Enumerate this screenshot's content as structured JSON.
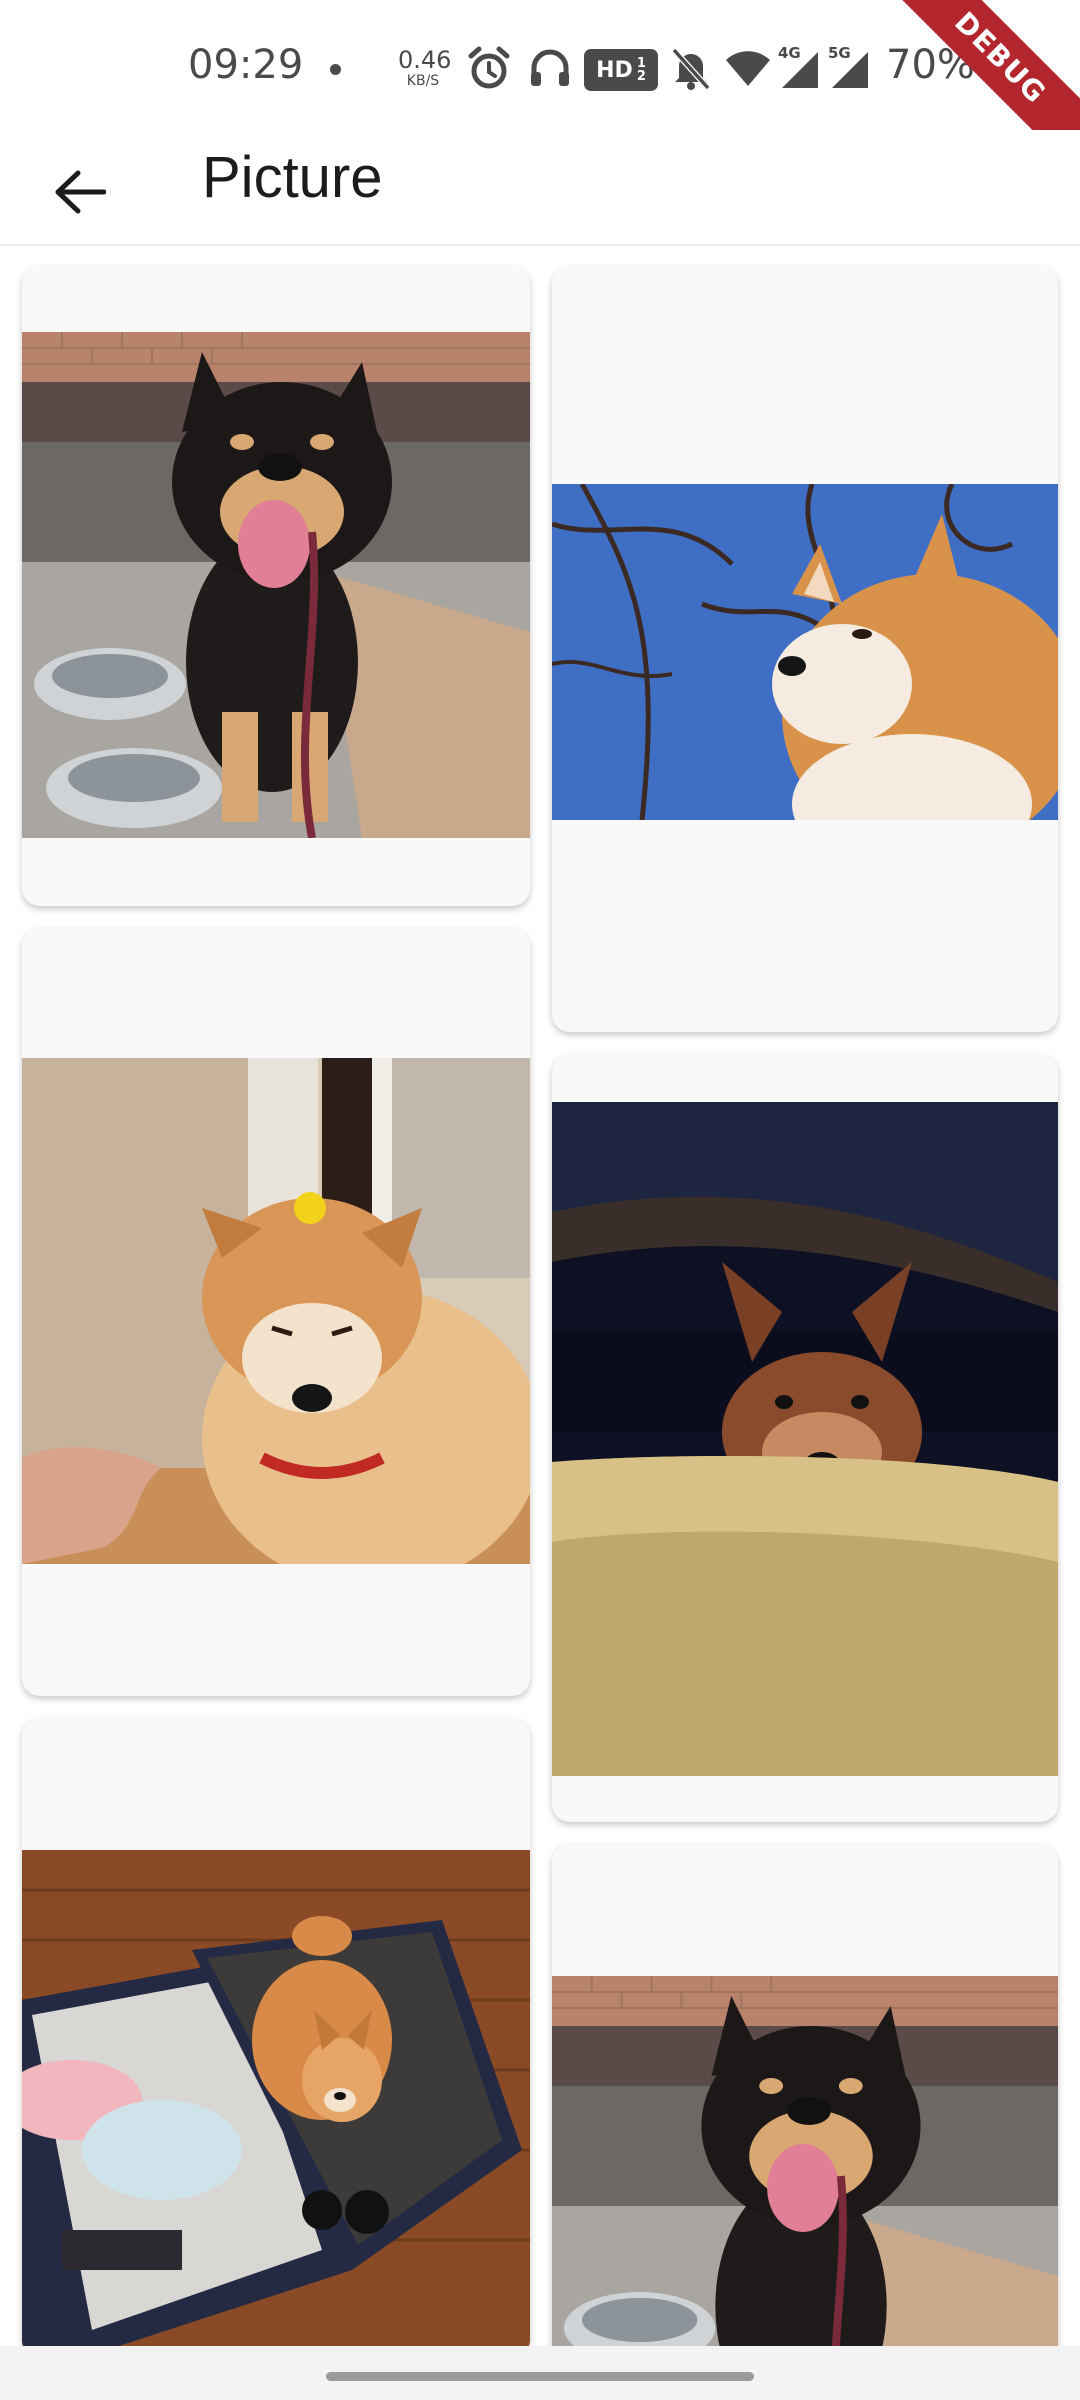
{
  "status_bar": {
    "time": "09:29",
    "net_speed_value": "0.46",
    "net_speed_unit": "KB/S",
    "hd_label": "HD",
    "battery": "70%",
    "debug_label": "DEBUG",
    "icons": [
      "alarm-icon",
      "headphones-icon",
      "hd-voice-icon",
      "mute-icon",
      "wifi-icon",
      "4g-signal-icon",
      "5g-signal-icon",
      "battery-icon"
    ]
  },
  "app_bar": {
    "back_icon": "back-arrow-icon",
    "title": "Picture"
  },
  "gallery": {
    "columns": 2,
    "items": [
      {
        "column": "left",
        "subject": "black-and-tan shiba with tongue out beside steel bowls"
      },
      {
        "column": "right",
        "subject": "red shiba against blue sky and branches"
      },
      {
        "column": "left",
        "subject": "shiba with yellow flower on head, red collar"
      },
      {
        "column": "right",
        "subject": "shiba peeking from under a couch"
      },
      {
        "column": "left",
        "subject": "shiba puppy inside open suitcase on wooden floor"
      },
      {
        "column": "right",
        "subject": "black-and-tan shiba with tongue out beside steel bowls"
      }
    ]
  },
  "colors": {
    "app_bar_bg": "#ffffff",
    "card_bg": "#f9f9f9",
    "text": "#1c1c1c",
    "status_text": "#4a4a4a",
    "debug_banner": "#b3262d"
  }
}
